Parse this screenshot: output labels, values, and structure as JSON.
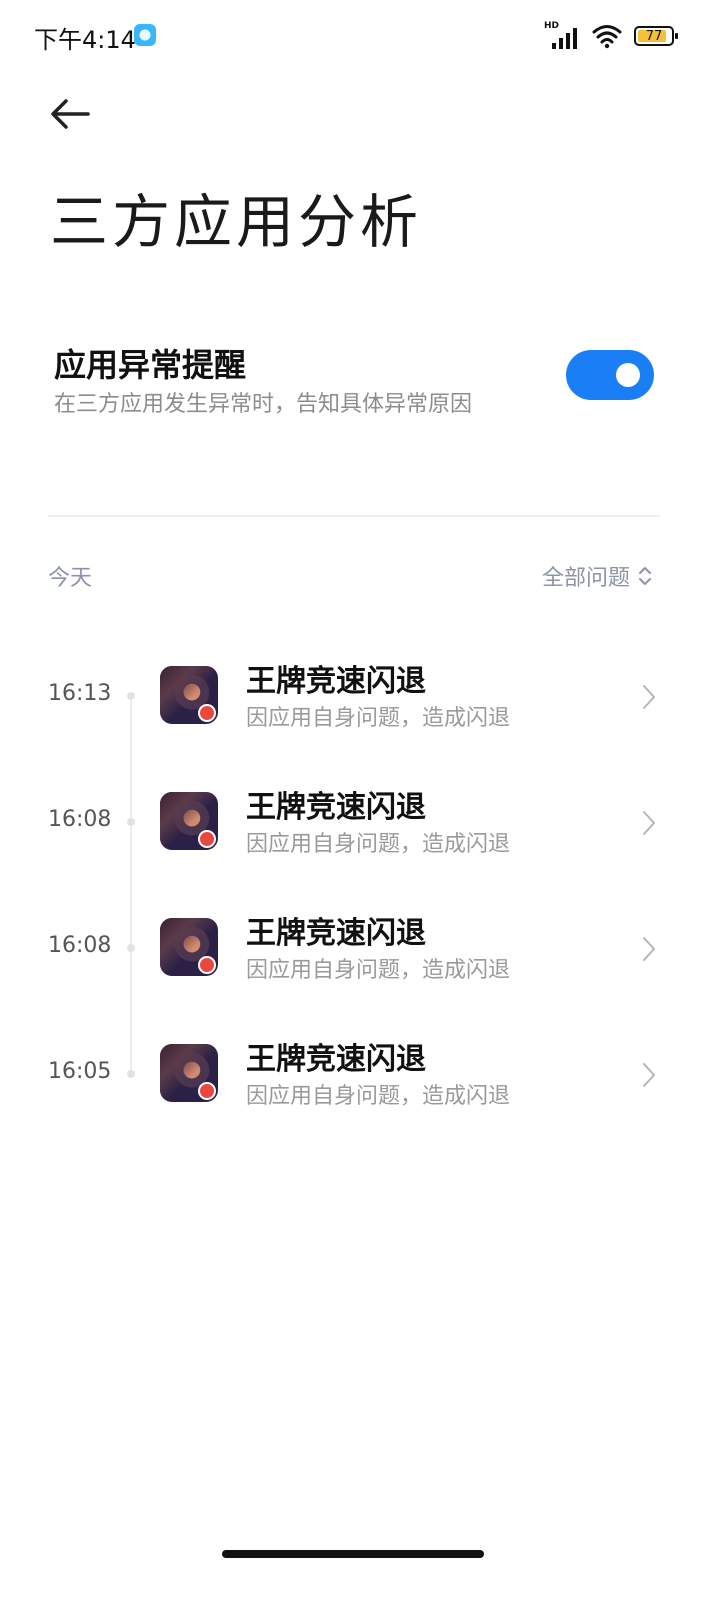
{
  "status_bar": {
    "time": "下午4:14",
    "network_label": "HD",
    "battery_level": "77",
    "battery_fraction": 0.77,
    "battery_color": "#f5c038"
  },
  "header": {
    "back_icon": "arrow-left-icon",
    "title": "三方应用分析"
  },
  "setting": {
    "title": "应用异常提醒",
    "subtitle": "在三方应用发生异常时，告知具体异常原因",
    "enabled": true,
    "toggle_color": "#1a7ef5"
  },
  "filter_row": {
    "date_label": "今天",
    "filter_label": "全部问题",
    "filter_icon": "chevron-up-down-icon"
  },
  "entries": [
    {
      "time": "16:13",
      "title": "王牌竞速闪退",
      "subtitle": "因应用自身问题，造成闪退"
    },
    {
      "time": "16:08",
      "title": "王牌竞速闪退",
      "subtitle": "因应用自身问题，造成闪退"
    },
    {
      "time": "16:08",
      "title": "王牌竞速闪退",
      "subtitle": "因应用自身问题，造成闪退"
    },
    {
      "time": "16:05",
      "title": "王牌竞速闪退",
      "subtitle": "因应用自身问题，造成闪退"
    }
  ]
}
